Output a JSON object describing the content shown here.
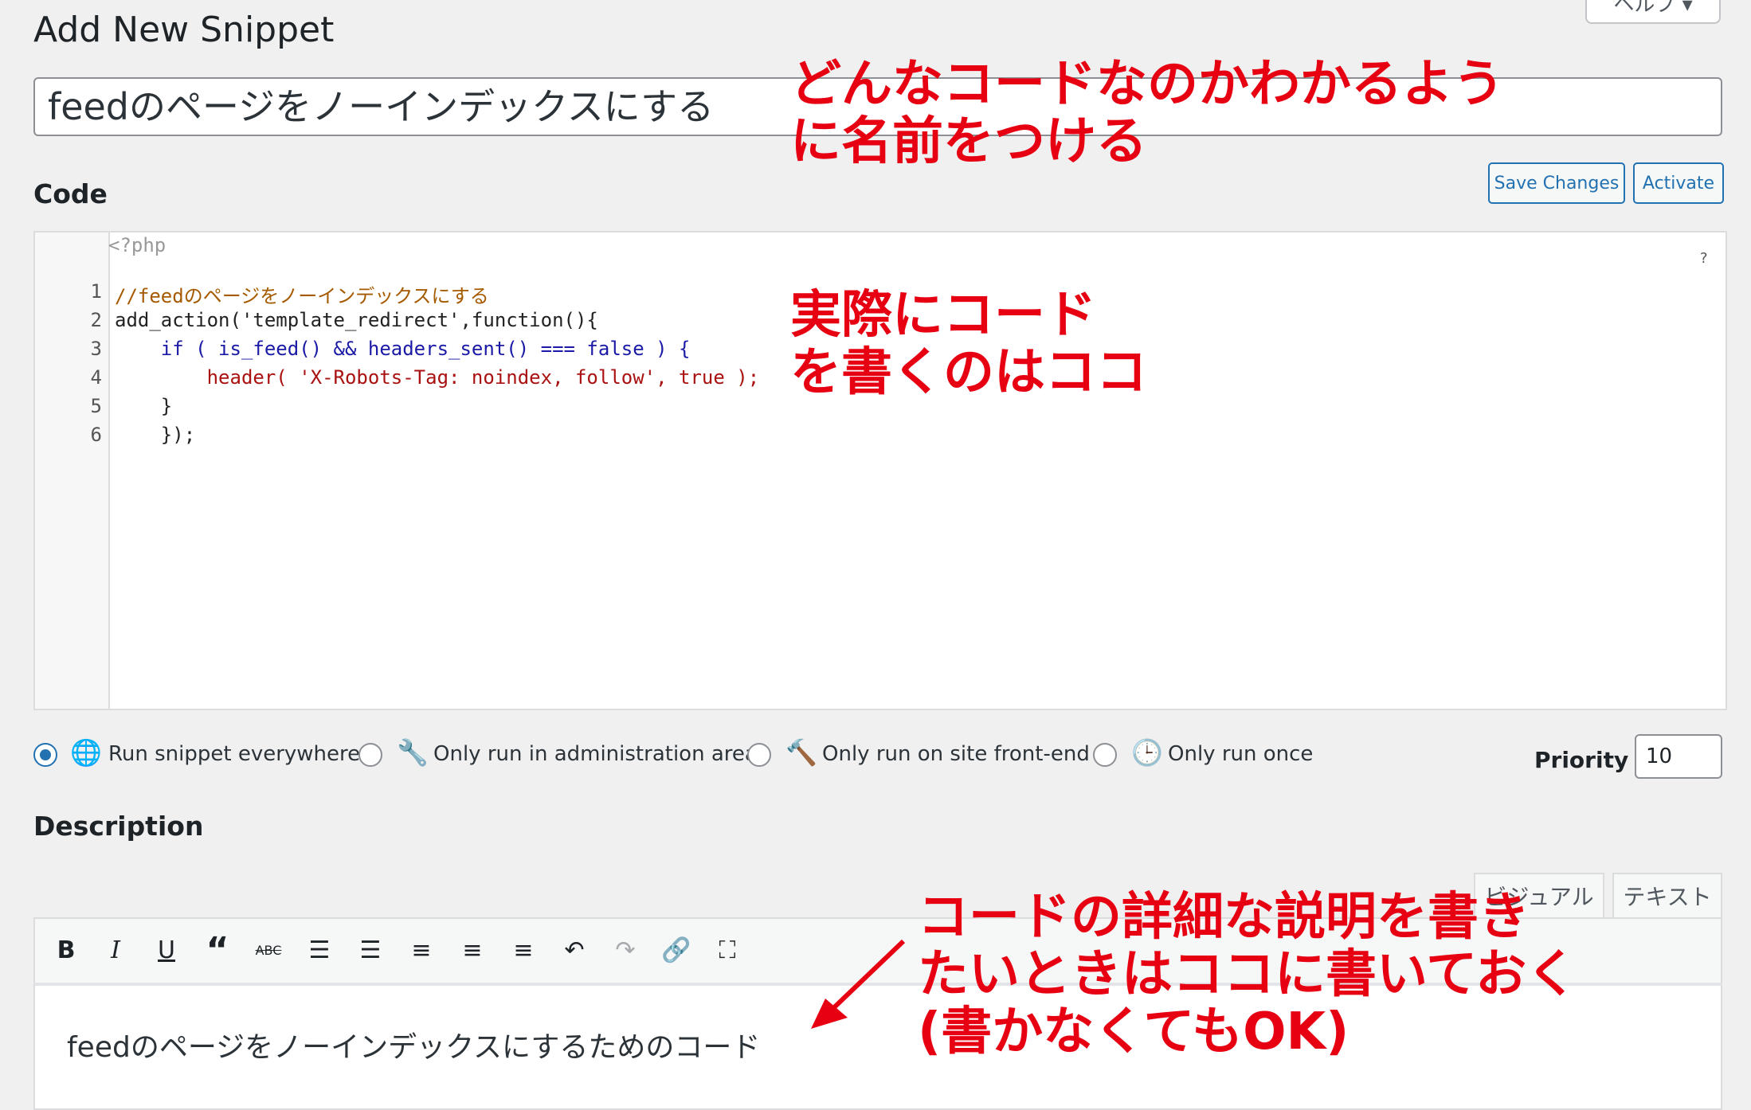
{
  "help_label": "ヘルプ ▾",
  "page_title": "Add New Snippet",
  "snippet_title": "feedのページをノーインデックスにする",
  "code_section": {
    "label": "Code",
    "save_label": "Save Changes",
    "activate_label": "Activate",
    "php_open": "<?php",
    "help_mark": "?",
    "lines": [
      {
        "num": "1",
        "text": "//feedのページをノーインデックスにする"
      },
      {
        "num": "2",
        "text": "add_action('template_redirect',function(){"
      },
      {
        "num": "3",
        "text": "    if ( is_feed() && headers_sent() === false ) {"
      },
      {
        "num": "4",
        "text": "        header( 'X-Robots-Tag: noindex, follow', true );"
      },
      {
        "num": "5",
        "text": "    }"
      },
      {
        "num": "6",
        "text": "    });"
      }
    ]
  },
  "scope_options": [
    {
      "label": "Run snippet everywhere",
      "icon": "globe-icon",
      "checked": true
    },
    {
      "label": "Only run in administration area",
      "icon": "wrench-icon",
      "checked": false
    },
    {
      "label": "Only run on site front-end",
      "icon": "hammer-icon",
      "checked": false
    },
    {
      "label": "Only run once",
      "icon": "clock-icon",
      "checked": false
    }
  ],
  "priority": {
    "label": "Priority",
    "value": "10"
  },
  "description": {
    "label": "Description",
    "tabs": [
      "ビジュアル",
      "テキスト"
    ],
    "text": "feedのページをノーインデックスにするためのコード"
  },
  "toolbar_icons": [
    "bold-icon",
    "italic-icon",
    "underline-icon",
    "blockquote-icon",
    "strikethrough-icon",
    "bullet-list-icon",
    "numbered-list-icon",
    "align-left-icon",
    "align-center-icon",
    "align-right-icon",
    "undo-icon",
    "redo-icon",
    "link-icon",
    "fullscreen-icon"
  ],
  "annotations": {
    "name_note": [
      "どんなコードなのかわかるよう",
      "に名前をつける"
    ],
    "code_note": [
      "実際にコード",
      "を書くのはココ"
    ],
    "desc_note": [
      "コードの詳細な説明を書き",
      "たいときはココに書いておく",
      "(書かなくてもOK)"
    ]
  },
  "colors": {
    "accent": "#2271b1",
    "annotation": "#e60012"
  }
}
